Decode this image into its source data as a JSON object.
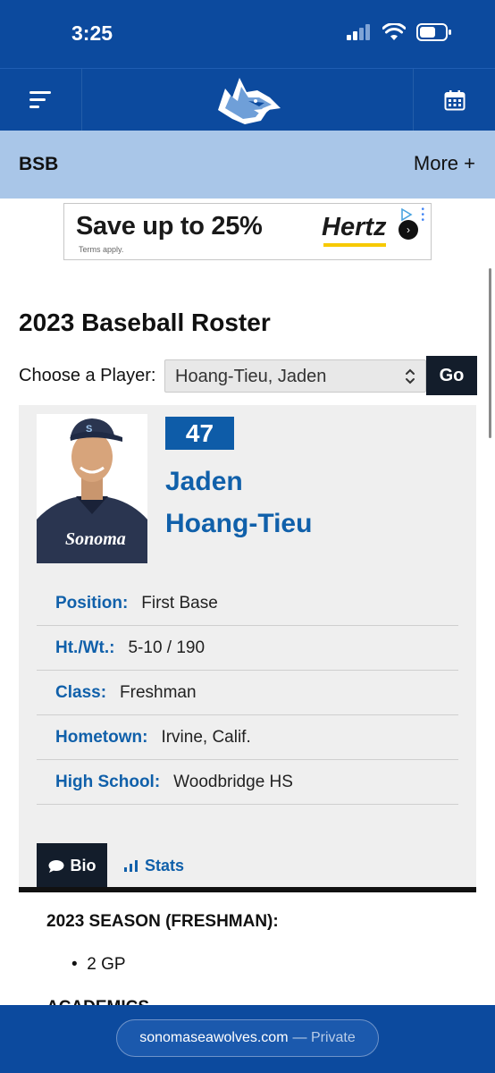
{
  "status_bar": {
    "time": "3:25"
  },
  "nav": {
    "section": "BSB",
    "more_label": "More +"
  },
  "ad": {
    "headline": "Save up to 25%",
    "terms": "Terms apply.",
    "brand": "Hertz"
  },
  "roster": {
    "title": "2023 Baseball Roster",
    "choose_label": "Choose a Player:",
    "selected_player": "Hoang-Tieu, Jaden",
    "go_label": "Go"
  },
  "player": {
    "number": "47",
    "first_name": "Jaden",
    "last_name": "Hoang-Tieu",
    "info": [
      {
        "label": "Position:",
        "value": "First Base"
      },
      {
        "label": "Ht./Wt.:",
        "value": "5-10 / 190"
      },
      {
        "label": "Class:",
        "value": "Freshman"
      },
      {
        "label": "Hometown:",
        "value": "Irvine, Calif."
      },
      {
        "label": "High School:",
        "value": "Woodbridge HS"
      }
    ]
  },
  "tabs": {
    "bio_label": "Bio",
    "stats_label": "Stats"
  },
  "bio": {
    "heading": "2023 SEASON (FRESHMAN):",
    "items": [
      "2 GP"
    ],
    "next_heading": "ACADEMICS"
  },
  "browser": {
    "url": "sonomaseawolves.com",
    "private_label": "— Private"
  },
  "colors": {
    "brand_blue": "#0c4a9e",
    "link_blue": "#1060aa",
    "nav_light": "#a9c6e8",
    "dark": "#131d2b"
  },
  "icons": [
    "menu-icon",
    "seawolf-logo",
    "calendar-icon",
    "chevron-updown-icon",
    "speech-bubble-icon",
    "bar-chart-icon",
    "signal-icon",
    "wifi-icon",
    "battery-icon"
  ]
}
